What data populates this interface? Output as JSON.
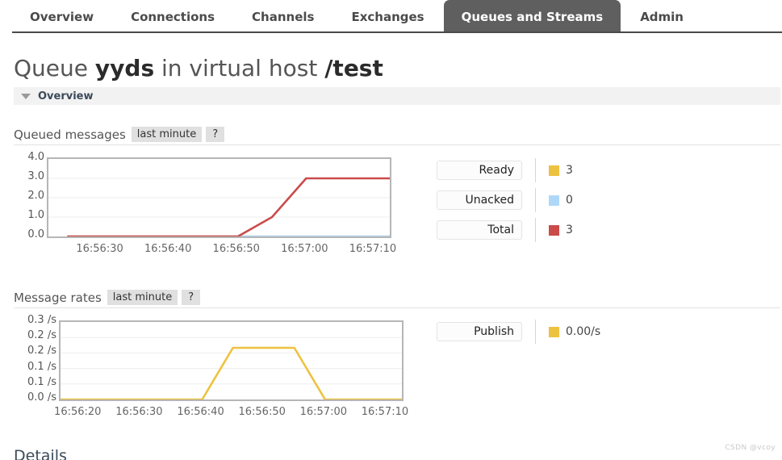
{
  "nav": {
    "items": [
      {
        "label": "Overview",
        "active": false
      },
      {
        "label": "Connections",
        "active": false
      },
      {
        "label": "Channels",
        "active": false
      },
      {
        "label": "Exchanges",
        "active": false
      },
      {
        "label": "Queues and Streams",
        "active": true
      },
      {
        "label": "Admin",
        "active": false
      }
    ]
  },
  "page": {
    "title_prefix": "Queue ",
    "title_queue": "yyds",
    "title_middle": " in virtual host ",
    "title_vhost": "/test",
    "section_label": "Overview",
    "details_label": "Details",
    "watermark": "CSDN @vcoy"
  },
  "colors": {
    "ready": "#edc240",
    "unacked": "#afd8f8",
    "total": "#cb4b4b",
    "publish": "#edc240",
    "active_tab_bg": "#5f5f5f",
    "plot_border": "#b6b6b6",
    "grid": "#ededed"
  },
  "queued_messages": {
    "title": "Queued messages",
    "range_label": "last minute",
    "help_label": "?",
    "legend": [
      {
        "name": "Ready",
        "value": "3",
        "color": "#edc240"
      },
      {
        "name": "Unacked",
        "value": "0",
        "color": "#afd8f8"
      },
      {
        "name": "Total",
        "value": "3",
        "color": "#cb4b4b"
      }
    ]
  },
  "message_rates": {
    "title": "Message rates",
    "range_label": "last minute",
    "help_label": "?",
    "legend": [
      {
        "name": "Publish",
        "value": "0.00/s",
        "color": "#edc240"
      }
    ]
  },
  "chart_data": [
    {
      "type": "line",
      "id": "queued-messages",
      "title": "Queued messages",
      "subtitle": "last minute",
      "xlabel": "",
      "ylabel": "",
      "ylim": [
        0,
        4
      ],
      "yticks": [
        0.0,
        1.0,
        2.0,
        3.0,
        4.0
      ],
      "ytick_labels": [
        "0.0",
        "1.0",
        "2.0",
        "3.0",
        "4.0"
      ],
      "xticks": [
        "16:56:30",
        "16:56:40",
        "16:56:50",
        "16:57:00",
        "16:57:10"
      ],
      "xtick_positions": [
        0.155,
        0.355,
        0.555,
        0.755,
        0.955
      ],
      "grid": true,
      "legend_position": "right",
      "series": [
        {
          "name": "Total",
          "color": "#cb4b4b",
          "x": [
            "16:56:25",
            "16:56:50",
            "16:56:55",
            "16:57:00",
            "16:57:15"
          ],
          "values": [
            0,
            0,
            1.0,
            3.0,
            3.0
          ]
        },
        {
          "name": "Unacked",
          "color": "#afd8f8",
          "x": [
            "16:56:25",
            "16:57:15"
          ],
          "values": [
            0,
            0
          ]
        },
        {
          "name": "Ready",
          "color": "#edc240",
          "x": [
            "16:56:25",
            "16:57:15"
          ],
          "values": [
            0,
            0
          ]
        }
      ]
    },
    {
      "type": "line",
      "id": "message-rates",
      "title": "Message rates",
      "subtitle": "last minute",
      "xlabel": "",
      "ylabel": "",
      "ylim": [
        0,
        0.3
      ],
      "yticks": [
        0.0,
        0.06,
        0.12,
        0.18,
        0.24,
        0.3
      ],
      "ytick_labels": [
        "0.0 /s",
        "0.1 /s",
        "0.1 /s",
        "0.2 /s",
        "0.2 /s",
        "0.3 /s"
      ],
      "xticks": [
        "16:56:20",
        "16:56:30",
        "16:56:40",
        "16:56:50",
        "16:57:00",
        "16:57:10"
      ],
      "xtick_positions": [
        0.055,
        0.235,
        0.415,
        0.595,
        0.775,
        0.955
      ],
      "grid": true,
      "legend_position": "right",
      "series": [
        {
          "name": "Publish",
          "color": "#edc240",
          "x": [
            "16:56:15",
            "16:56:40",
            "16:56:45",
            "16:56:55",
            "16:57:00",
            "16:57:15"
          ],
          "values": [
            0,
            0,
            0.2,
            0.2,
            0,
            0
          ]
        }
      ]
    }
  ]
}
